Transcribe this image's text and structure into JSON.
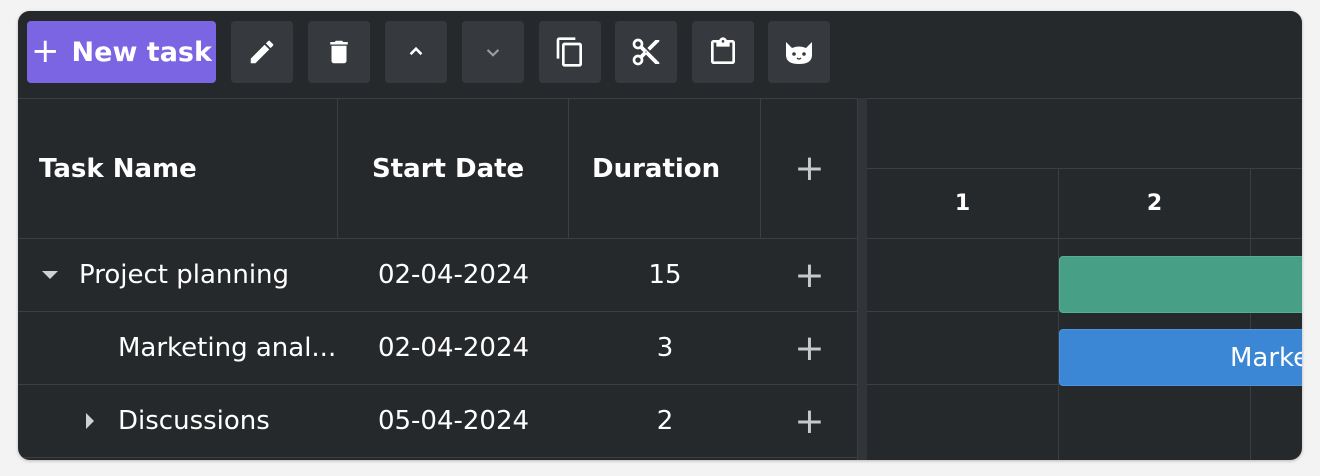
{
  "toolbar": {
    "new_task_label": "New task",
    "buttons": [
      {
        "name": "edit-button",
        "icon": "pencil-icon"
      },
      {
        "name": "delete-button",
        "icon": "trash-icon"
      },
      {
        "name": "move-up-button",
        "icon": "chevron-up-icon"
      },
      {
        "name": "move-down-button",
        "icon": "chevron-down-icon"
      },
      {
        "name": "copy-button",
        "icon": "copy-icon"
      },
      {
        "name": "cut-button",
        "icon": "scissors-icon"
      },
      {
        "name": "paste-button",
        "icon": "clipboard-icon"
      },
      {
        "name": "theme-button",
        "icon": "cat-icon"
      }
    ]
  },
  "grid": {
    "columns": {
      "task_name": "Task Name",
      "start_date": "Start Date",
      "duration": "Duration",
      "add": "+"
    },
    "rows": [
      {
        "name": "Project planning",
        "start": "02-04-2024",
        "duration": "15",
        "expander": "expanded"
      },
      {
        "name": "Marketing anal...",
        "start": "02-04-2024",
        "duration": "3",
        "expander": "none"
      },
      {
        "name": "Discussions",
        "start": "05-04-2024",
        "duration": "2",
        "expander": "collapsed"
      }
    ],
    "add_label": "+"
  },
  "timeline": {
    "days": [
      "1",
      "2"
    ],
    "bars": [
      {
        "type": "project",
        "label": ""
      },
      {
        "type": "task",
        "label": "Marketing analysis"
      }
    ]
  },
  "colors": {
    "accent": "#7b65e3",
    "project_bar": "#47a085",
    "task_bar": "#3b87d5",
    "background": "#26292b"
  }
}
